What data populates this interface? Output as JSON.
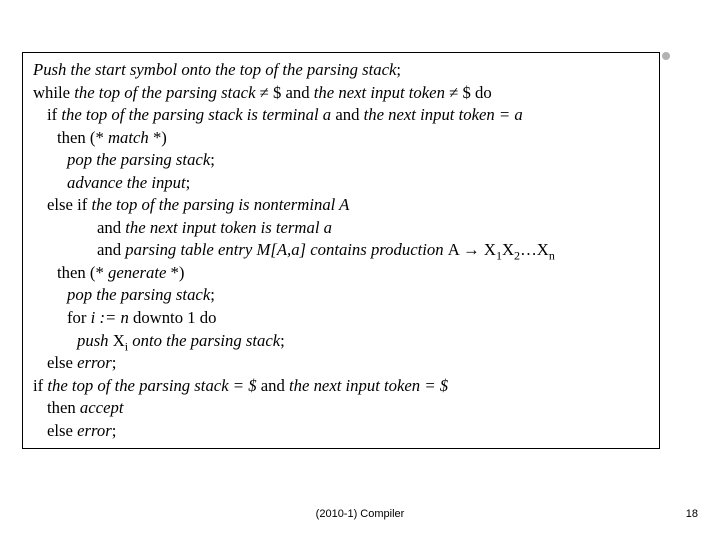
{
  "algo": {
    "l1_a": "Push the start symbol onto the top of the parsing stack",
    "l1_b": ";",
    "l2_a": "while",
    "l2_b": " the top of the parsing stack ",
    "l2_c": "≠",
    "l2_d": " $ ",
    "l2_e": "and",
    "l2_f": " the next input token ",
    "l2_g": "≠",
    "l2_h": " $ ",
    "l2_i": "do",
    "l3_a": "if",
    "l3_b": " the top of the parsing stack is terminal a ",
    "l3_c": "and",
    "l3_d": " the next input token = a",
    "l4_a": "then",
    "l4_b": " (* ",
    "l4_c": "match",
    "l4_d": " *)",
    "l5_a": "pop the parsing stack",
    "l5_b": ";",
    "l6_a": "advance the input",
    "l6_b": ";",
    "l7_a": "else if",
    "l7_b": " the top of the parsing is nonterminal A",
    "l8_a": "and",
    "l8_b": " the next input token is termal a",
    "l9_a": "and",
    "l9_b": " parsing table entry M[A,a] contains production ",
    "l9_c": "A ",
    "l9_d": "→",
    "l9_e": " X",
    "l9_f": "1",
    "l9_g": "X",
    "l9_h": "2",
    "l9_i": "…X",
    "l9_j": "n",
    "l10_a": "then",
    "l10_b": " (* ",
    "l10_c": "generate",
    "l10_d": " *)",
    "l11_a": "pop the parsing stack",
    "l11_b": ";",
    "l12_a": "for",
    "l12_b": " i := n ",
    "l12_c": "downto",
    "l12_d": " 1 ",
    "l12_e": "do",
    "l13_a": "push ",
    "l13_b": "X",
    "l13_c": "i",
    "l13_d": " onto the parsing stack",
    "l13_e": ";",
    "l14_a": "else",
    "l14_b": " error",
    "l14_c": ";",
    "l15_a": "if",
    "l15_b": " the top of the parsing stack = $ ",
    "l15_c": "and",
    "l15_d": " the next input token = $",
    "l16_a": "then",
    "l16_b": " accept",
    "l17_a": "else",
    "l17_b": " error",
    "l17_c": ";"
  },
  "footer": "(2010-1) Compiler",
  "pagenum": "18"
}
